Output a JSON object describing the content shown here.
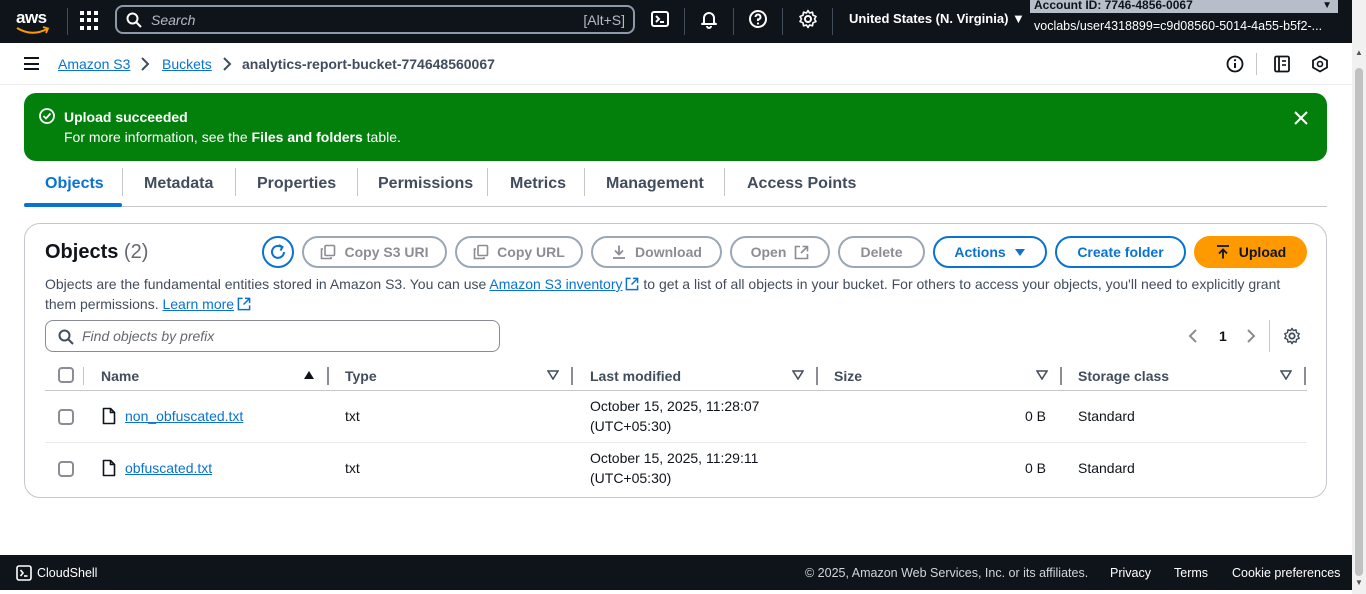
{
  "topnav": {
    "logo_text": "aws",
    "search_placeholder": "Search",
    "search_shortcut": "[Alt+S]",
    "region": "United States (N. Virginia) ▼",
    "account_id": "Account ID: 7746-4856-0067",
    "user": "voclabs/user4318899=c9d08560-5014-4a55-b5f2-..."
  },
  "breadcrumb": {
    "items": [
      "Amazon S3",
      "Buckets"
    ],
    "current": "analytics-report-bucket-774648560067"
  },
  "flash": {
    "title": "Upload succeeded",
    "message_before": "For more information, see the ",
    "message_bold": "Files and folders",
    "message_after": " table."
  },
  "tabs": [
    "Objects",
    "Metadata",
    "Properties",
    "Permissions",
    "Metrics",
    "Management",
    "Access Points"
  ],
  "objects": {
    "title": "Objects",
    "count": "(2)",
    "buttons": {
      "copy_s3_uri": "Copy S3 URI",
      "copy_url": "Copy URL",
      "download": "Download",
      "open": "Open",
      "delete": "Delete",
      "actions": "Actions",
      "create_folder": "Create folder",
      "upload": "Upload"
    },
    "desc_1": "Objects are the fundamental entities stored in Amazon S3. You can use ",
    "desc_link": "Amazon S3 inventory",
    "desc_2": " to get a list of all objects in your bucket. For others to access your objects, you'll need to explicitly grant them permissions. ",
    "learn_more": "Learn more",
    "filter_placeholder": "Find objects by prefix",
    "page": "1",
    "columns": [
      "Name",
      "Type",
      "Last modified",
      "Size",
      "Storage class"
    ],
    "rows": [
      {
        "name": "non_obfuscated.txt",
        "type": "txt",
        "modified_1": "October 15, 2025, 11:28:07",
        "modified_2": "(UTC+05:30)",
        "size": "0 B",
        "storage": "Standard"
      },
      {
        "name": "obfuscated.txt",
        "type": "txt",
        "modified_1": "October 15, 2025, 11:29:11",
        "modified_2": "(UTC+05:30)",
        "size": "0 B",
        "storage": "Standard"
      }
    ]
  },
  "footer": {
    "cloudshell": "CloudShell",
    "copyright": "© 2025, Amazon Web Services, Inc. or its affiliates.",
    "privacy": "Privacy",
    "terms": "Terms",
    "cookies": "Cookie preferences"
  }
}
